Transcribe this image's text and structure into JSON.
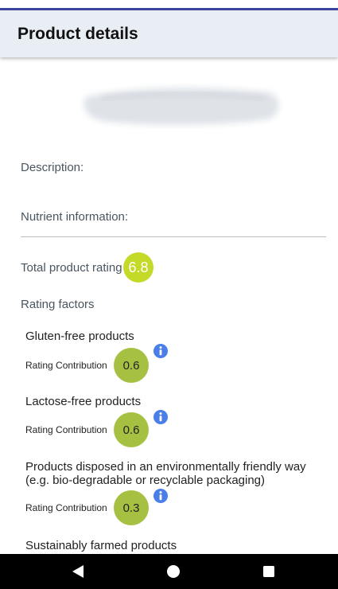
{
  "app_bar": {
    "title": "Product details"
  },
  "product": {
    "description_label": "Description:",
    "nutrient_label": "Nutrient information:"
  },
  "rating": {
    "total_label": "Total product rating",
    "total_value": "6.8",
    "factors_heading": "Rating factors"
  },
  "factors": [
    {
      "title": "Gluten-free products",
      "contribution_label": "Rating Contribution",
      "contribution_value": "0.6"
    },
    {
      "title": "Lactose-free products",
      "contribution_label": "Rating Contribution",
      "contribution_value": "0.6"
    },
    {
      "title": "Products disposed in an environmentally friendly way (e.g. bio-degradable or recyclable packaging)",
      "contribution_label": "Rating Contribution",
      "contribution_value": "0.3"
    },
    {
      "title": "Sustainably farmed products"
    }
  ],
  "icons": {
    "info": "info-icon",
    "back": "back-triangle-icon",
    "home": "home-circle-icon",
    "recents": "recents-square-icon"
  },
  "colors": {
    "accent_bar": "#3e45a3",
    "app_bar_bg": "#e9eef4",
    "total_rating": "#c5d928",
    "contribution": "#a6c142",
    "info_icon": "#4a7ee8"
  }
}
